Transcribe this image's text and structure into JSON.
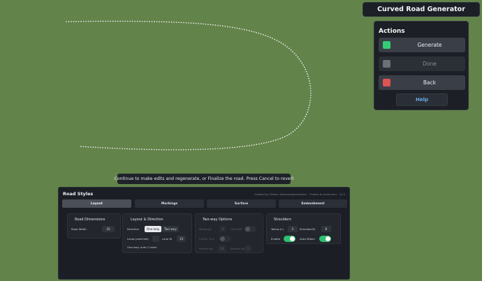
{
  "title": "Curved Road Generator",
  "actions": {
    "heading": "Actions",
    "buttons": [
      {
        "label": "Generate",
        "color": "#33cc77",
        "enabled": true
      },
      {
        "label": "Done",
        "color": "#6b6f78",
        "enabled": false
      },
      {
        "label": "Back",
        "color": "#e05353",
        "enabled": true
      }
    ],
    "help_label": "Help"
  },
  "hint": "Continue to make edits and regenerate, or Finalize the road. Press Cancel to revert",
  "road_styles": {
    "title": "Road Styles",
    "credit": "Created by Firebus (fbooroadgenerator) · Thanks to mybrickcs · v2.0",
    "tabs": [
      {
        "label": "Layout",
        "active": true
      },
      {
        "label": "Markings",
        "active": false
      },
      {
        "label": "Surface",
        "active": false
      },
      {
        "label": "Embankment",
        "active": false
      }
    ],
    "road_dimensions": {
      "title": "Road Dimensions",
      "road_width_label": "Road Width",
      "road_width_value": "25"
    },
    "layout_direction": {
      "title": "Layout & Direction",
      "direction_label": "Direction",
      "direction_options": [
        "One-way",
        "Two-way"
      ],
      "direction_selected": "One-way",
      "lanes_label": "Lanes",
      "lanes_override": "(override)",
      "lanes_value": "",
      "lane_w_label": "Lane W",
      "lane_w_value": "13",
      "summary": "One-way: auto 1 lanes"
    },
    "two_way": {
      "title": "Two-way Options",
      "median_label": "Median/E",
      "median_value": "0",
      "hide_flat_label": "Hide flat",
      "center_turn_label": "Center Turn",
      "fwd_lanes_label": "Fwd/W lbg",
      "fwd_lanes_value": "24",
      "back_lanes_label": "Back/W lbl",
      "back_lanes_value": "1"
    },
    "shoulders": {
      "title": "Shoulders",
      "yellow_label": "Yellow (L)",
      "yellow_value": "2",
      "shoulder_label": "Shoulder(R)",
      "shoulder_value": "6",
      "enable_label": "Enable",
      "enable_on": true,
      "auto_widen_label": "Auto Widen",
      "auto_widen_on": true
    }
  }
}
